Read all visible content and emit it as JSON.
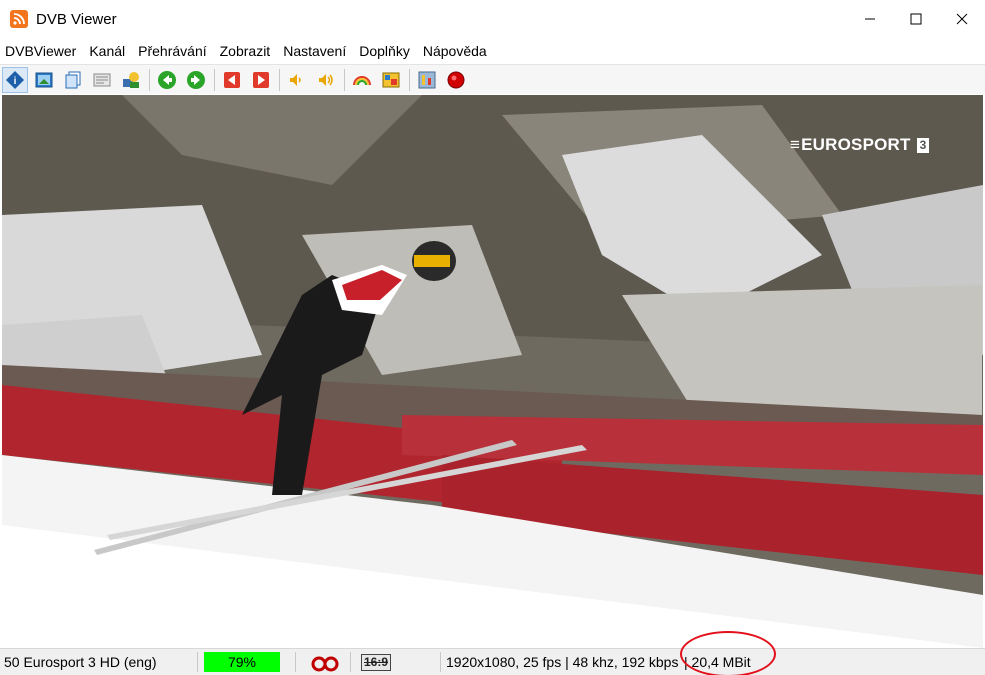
{
  "window": {
    "title": "DVB Viewer",
    "icon": "rss-icon"
  },
  "menu": {
    "items": [
      "DVBViewer",
      "Kanál",
      "Přehrávání",
      "Zobrazit",
      "Nastavení",
      "Doplňky",
      "Nápověda"
    ]
  },
  "toolbar": {
    "buttons": [
      {
        "name": "info-icon",
        "active": true
      },
      {
        "name": "picture-icon"
      },
      {
        "name": "copy-window-icon"
      },
      {
        "name": "teletext-icon"
      },
      {
        "name": "epg-icon"
      },
      {
        "name": "back-green-icon"
      },
      {
        "name": "forward-green-icon"
      },
      {
        "name": "prev-red-icon"
      },
      {
        "name": "next-red-icon"
      },
      {
        "name": "volume-down-icon"
      },
      {
        "name": "volume-up-icon"
      },
      {
        "name": "rainbow-icon"
      },
      {
        "name": "image-icon"
      },
      {
        "name": "settings-icon"
      },
      {
        "name": "record-icon"
      }
    ]
  },
  "video": {
    "channel_logo": "EUROSPORT",
    "channel_number": "3"
  },
  "status": {
    "channel": "50 Eurosport 3 HD (eng)",
    "signal": "79%",
    "signal_fraction": 0.79,
    "audio_icon": "stereo-icon",
    "aspect": "16:9",
    "stream_info": "1920x1080, 25 fps | 48 khz, 192 kbps",
    "bitrate": "| 20,4 MBit"
  },
  "colors": {
    "signal_green": "#00ff00",
    "highlight_red": "#e2101a",
    "record_red": "#d00000"
  }
}
